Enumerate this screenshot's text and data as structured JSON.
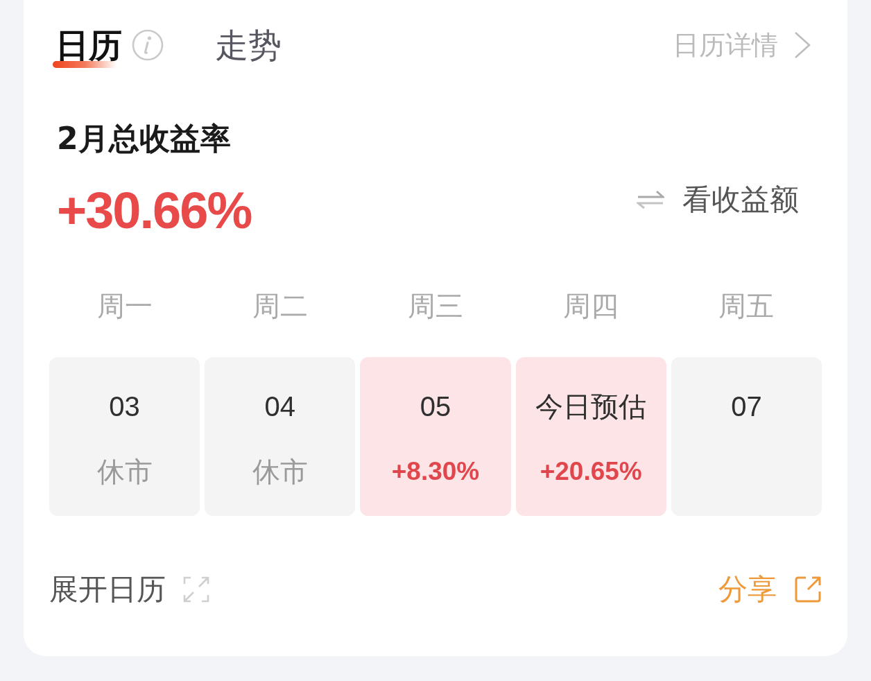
{
  "tabs": [
    {
      "label": "日历",
      "selected": true,
      "has_info": true
    },
    {
      "label": "走势",
      "selected": false,
      "has_info": false
    }
  ],
  "detail_link": "日历详情",
  "summary": {
    "title": "2月总收益率",
    "value": "+30.66%",
    "toggle": "看收益额"
  },
  "weekdays": [
    "周一",
    "周二",
    "周三",
    "周四",
    "周五"
  ],
  "days": [
    {
      "date": "03",
      "result": "休市",
      "kind": "closed"
    },
    {
      "date": "04",
      "result": "休市",
      "kind": "closed"
    },
    {
      "date": "05",
      "result": "+8.30%",
      "kind": "gain"
    },
    {
      "date": "今日预估",
      "result": "+20.65%",
      "kind": "gain"
    },
    {
      "date": "07",
      "kind": "upcoming"
    }
  ],
  "footer": {
    "expand": "展开日历",
    "share": "分享"
  }
}
